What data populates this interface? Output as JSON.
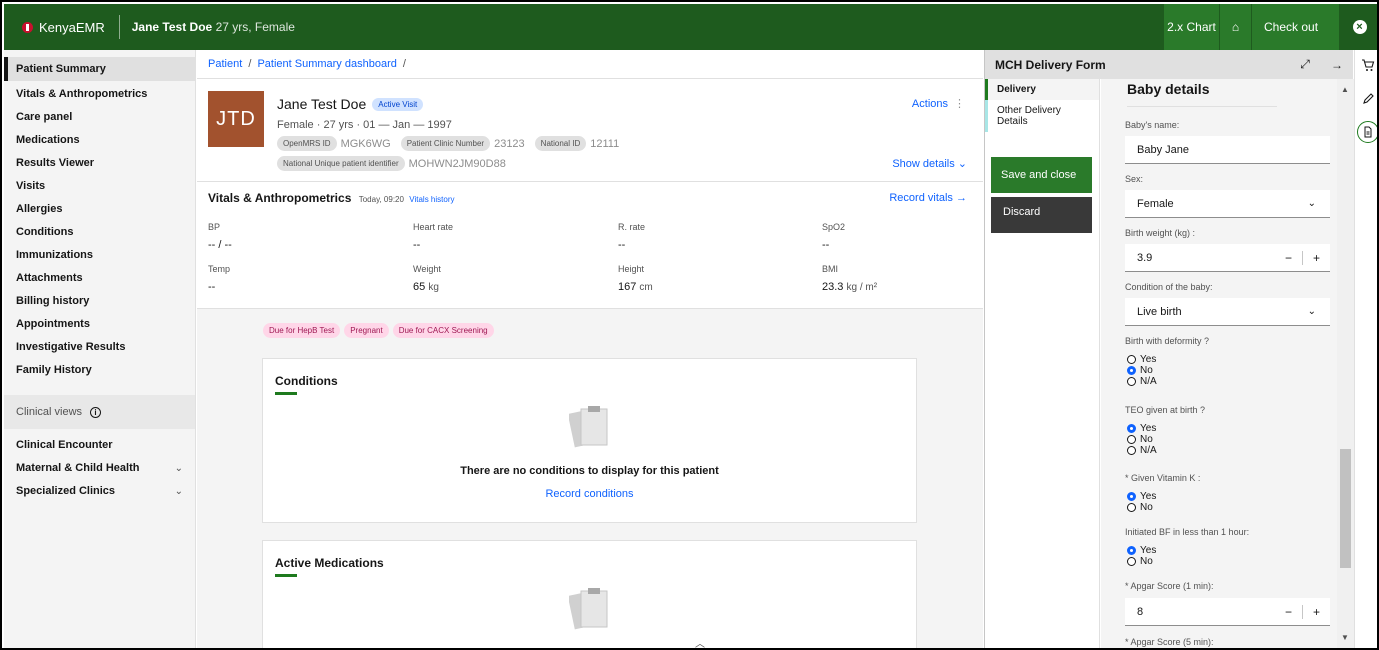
{
  "topbar": {
    "app_name": "KenyaEMR",
    "patient_name": "Jane Test Doe",
    "patient_meta": "27 yrs, Female",
    "chart_button": "2.x Chart",
    "home_icon": "home-icon",
    "checkout_button": "Check out",
    "close_icon": "close-icon"
  },
  "leftnav": {
    "items": [
      "Patient Summary",
      "Vitals & Anthropometrics",
      "Care panel",
      "Medications",
      "Results Viewer",
      "Visits",
      "Allergies",
      "Conditions",
      "Immunizations",
      "Attachments",
      "Billing history",
      "Appointments",
      "Investigative Results",
      "Family History"
    ],
    "clinical_views_label": "Clinical views",
    "clinical_items": [
      "Clinical Encounter",
      "Maternal & Child Health",
      "Specialized Clinics"
    ]
  },
  "breadcrumb": {
    "items": [
      "Patient",
      "Patient Summary dashboard"
    ],
    "sep": "/"
  },
  "banner": {
    "initials": "JTD",
    "name": "Jane Test Doe",
    "visit_tag": "Active Visit",
    "demographics": "Female · 27 yrs · 01 — Jan — 1997",
    "openmrs_label": "OpenMRS ID",
    "openmrs_value": "MGK6WG",
    "clinic_label": "Patient Clinic Number",
    "clinic_value": "23123",
    "national_label": "National ID",
    "national_value": "12111",
    "nupi_label": "National Unique patient identifier",
    "nupi_value": "MOHWN2JM90D88",
    "actions": "Actions",
    "show_details": "Show details"
  },
  "vitals": {
    "title": "Vitals & Anthropometrics",
    "time": "Today, 09:20",
    "history_link": "Vitals history",
    "record": "Record vitals",
    "bp_label": "BP",
    "bp_value": "-- / --",
    "hr_label": "Heart rate",
    "hr_value": "--",
    "rr_label": "R. rate",
    "rr_value": "--",
    "spo2_label": "SpO2",
    "spo2_value": "--",
    "temp_label": "Temp",
    "temp_value": "--",
    "weight_label": "Weight",
    "weight_value": "65",
    "weight_unit": "kg",
    "height_label": "Height",
    "height_value": "167",
    "height_unit": "cm",
    "bmi_label": "BMI",
    "bmi_value": "23.3",
    "bmi_unit": "kg / m²"
  },
  "flags": [
    "Due for HepB Test",
    "Pregnant",
    "Due for CACX Screening"
  ],
  "conditions": {
    "title": "Conditions",
    "empty": "There are no conditions to display for this patient",
    "link": "Record conditions"
  },
  "medications": {
    "title": "Active Medications"
  },
  "workspace": {
    "title": "MCH Delivery Form",
    "nav": [
      "Delivery",
      "Other Delivery Details"
    ],
    "save": "Save and close",
    "discard": "Discard",
    "section": "Baby details",
    "baby_name_label": "Baby's name:",
    "baby_name_value": "Baby Jane",
    "sex_label": "Sex:",
    "sex_value": "Female",
    "weight_label": "Birth weight (kg) :",
    "weight_value": "3.9",
    "condition_label": "Condition of the baby:",
    "condition_value": "Live birth",
    "deformity_label": "Birth with deformity ?",
    "deformity_options": [
      "Yes",
      "No",
      "N/A"
    ],
    "teo_label": "TEO given at birth ?",
    "teo_options": [
      "Yes",
      "No",
      "N/A"
    ],
    "vitk_label": "* Given Vitamin K :",
    "vitk_options": [
      "Yes",
      "No"
    ],
    "bf_label": "Initiated BF in less than 1 hour:",
    "bf_options": [
      "Yes",
      "No"
    ],
    "apgar1_label": "* Apgar Score (1 min):",
    "apgar1_value": "8",
    "apgar5_label": "* Apgar Score (5 min):"
  }
}
